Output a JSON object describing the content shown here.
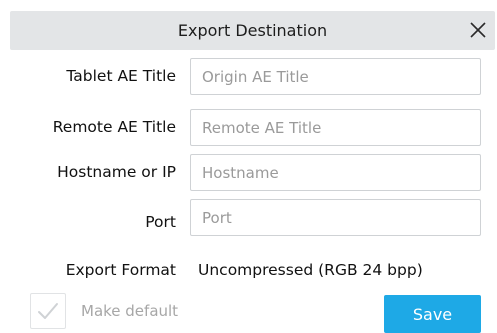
{
  "dialog": {
    "title": "Export Destination"
  },
  "form": {
    "tablet_ae_title": {
      "label": "Tablet AE Title",
      "value": "",
      "placeholder": "Origin AE Title"
    },
    "remote_ae_title": {
      "label": "Remote AE Title",
      "value": "",
      "placeholder": "Remote AE Title"
    },
    "hostname": {
      "label": "Hostname or IP",
      "value": "",
      "placeholder": "Hostname"
    },
    "port": {
      "label": "Port",
      "value": "",
      "placeholder": "Port"
    },
    "export_format": {
      "label": "Export Format",
      "value": "Uncompressed (RGB 24 bpp)"
    }
  },
  "footer": {
    "make_default_label": "Make default",
    "make_default_checked": false,
    "save_label": "Save"
  },
  "icons": {
    "close": "close-icon",
    "check": "checkmark-icon"
  },
  "colors": {
    "title_bar": "#e3e5e7",
    "save_button": "#1ea9e6",
    "input_border": "#cfd2d5",
    "placeholder": "#9a9a9a",
    "disabled_text": "#a7a7a7"
  }
}
